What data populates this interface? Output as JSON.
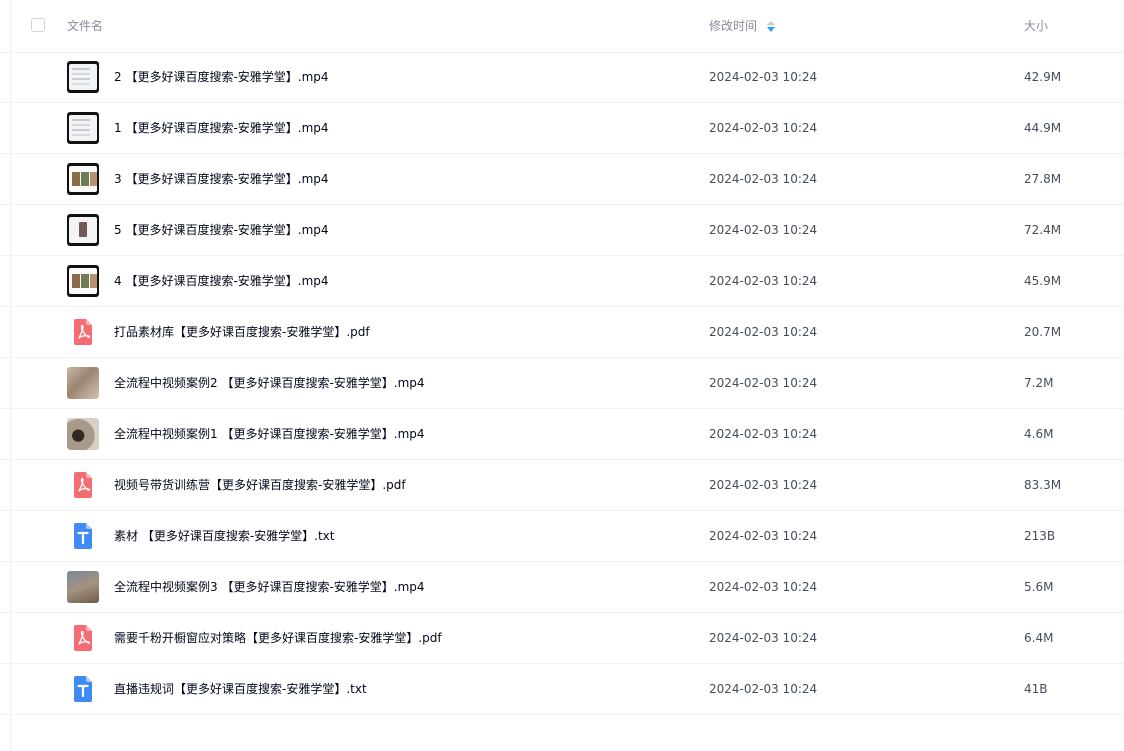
{
  "header": {
    "name_label": "文件名",
    "time_label": "修改时间",
    "size_label": "大小"
  },
  "colors": {
    "pdf": "#f56d74",
    "txt": "#3e8bf5",
    "sort_up": "#c4c9d2",
    "sort_down": "#2f9cf5"
  },
  "files": [
    {
      "name": "2 【更多好课百度搜索-安雅学堂】.mp4",
      "time": "2024-02-03 10:24",
      "size": "42.9M",
      "kind": "video"
    },
    {
      "name": "1 【更多好课百度搜索-安雅学堂】.mp4",
      "time": "2024-02-03 10:24",
      "size": "44.9M",
      "kind": "video"
    },
    {
      "name": "3 【更多好课百度搜索-安雅学堂】.mp4",
      "time": "2024-02-03 10:24",
      "size": "27.8M",
      "kind": "video"
    },
    {
      "name": "5 【更多好课百度搜索-安雅学堂】.mp4",
      "time": "2024-02-03 10:24",
      "size": "72.4M",
      "kind": "video"
    },
    {
      "name": "4 【更多好课百度搜索-安雅学堂】.mp4",
      "time": "2024-02-03 10:24",
      "size": "45.9M",
      "kind": "video"
    },
    {
      "name": "打品素材库【更多好课百度搜索-安雅学堂】.pdf",
      "time": "2024-02-03 10:24",
      "size": "20.7M",
      "kind": "pdf"
    },
    {
      "name": "全流程中视频案例2 【更多好课百度搜索-安雅学堂】.mp4",
      "time": "2024-02-03 10:24",
      "size": "7.2M",
      "kind": "photo"
    },
    {
      "name": "全流程中视频案例1 【更多好课百度搜索-安雅学堂】.mp4",
      "time": "2024-02-03 10:24",
      "size": "4.6M",
      "kind": "photo"
    },
    {
      "name": "视频号带货训练营【更多好课百度搜索-安雅学堂】.pdf",
      "time": "2024-02-03 10:24",
      "size": "83.3M",
      "kind": "pdf"
    },
    {
      "name": "素材 【更多好课百度搜索-安雅学堂】.txt",
      "time": "2024-02-03 10:24",
      "size": "213B",
      "kind": "txt"
    },
    {
      "name": "全流程中视频案例3 【更多好课百度搜索-安雅学堂】.mp4",
      "time": "2024-02-03 10:24",
      "size": "5.6M",
      "kind": "photo"
    },
    {
      "name": "需要千粉开橱窗应对策略【更多好课百度搜索-安雅学堂】.pdf",
      "time": "2024-02-03 10:24",
      "size": "6.4M",
      "kind": "pdf"
    },
    {
      "name": "直播违规词【更多好课百度搜索-安雅学堂】.txt",
      "time": "2024-02-03 10:24",
      "size": "41B",
      "kind": "txt"
    }
  ]
}
